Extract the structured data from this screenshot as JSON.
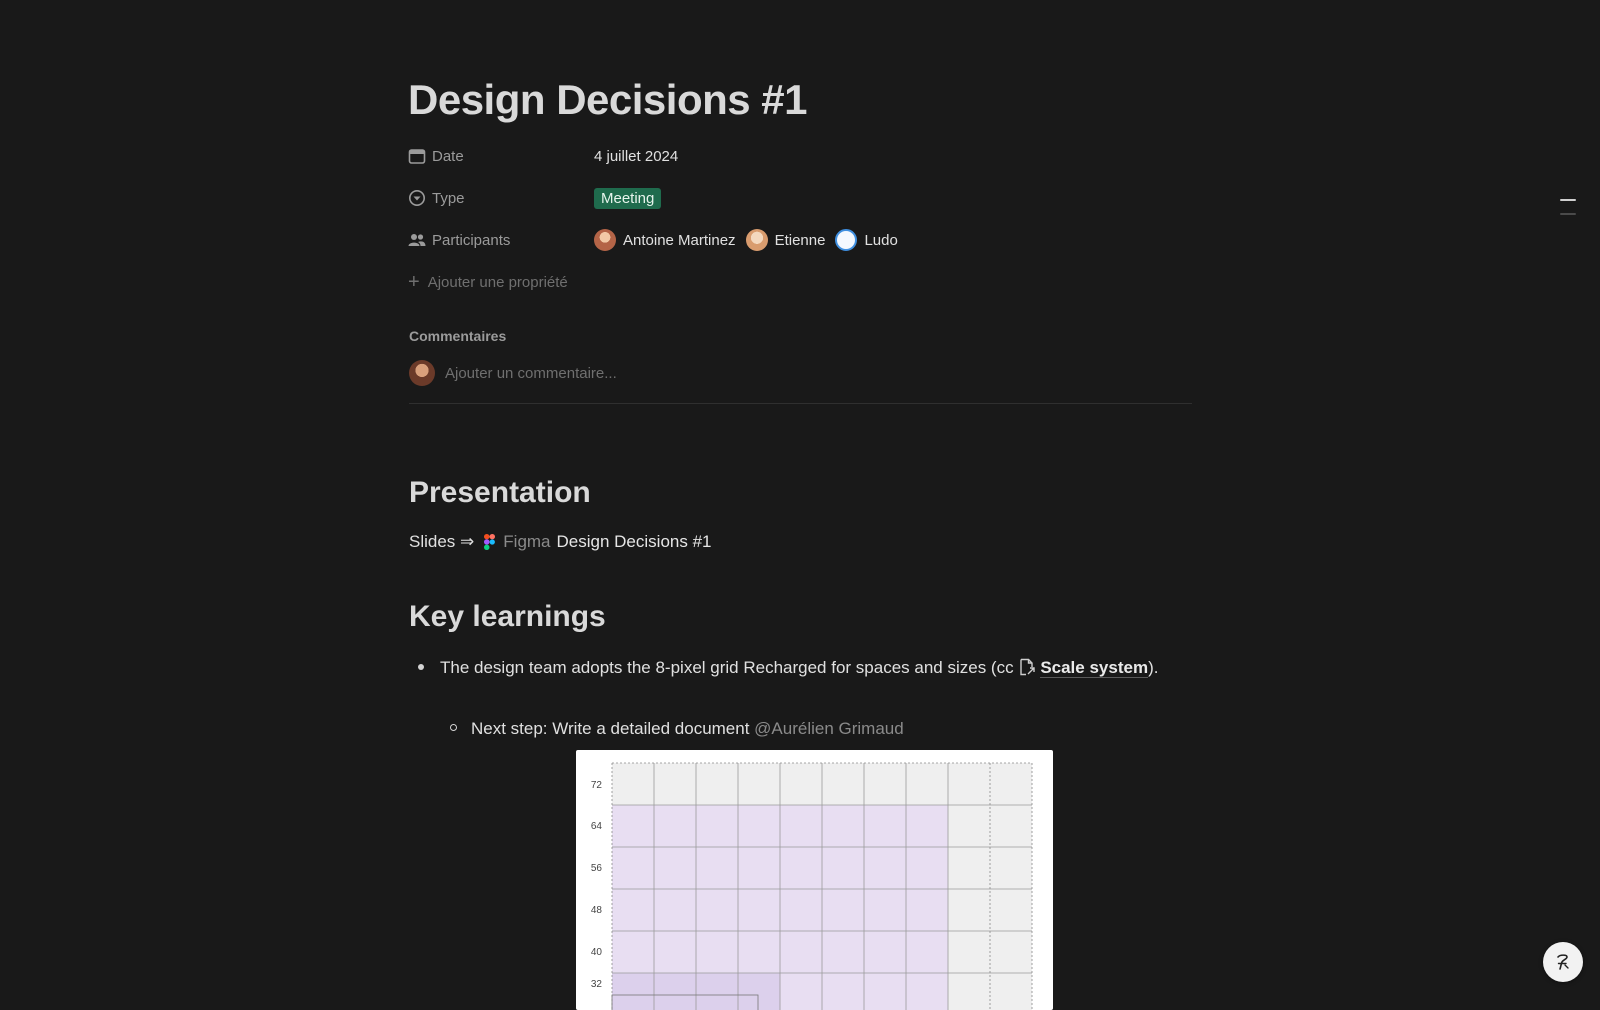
{
  "page": {
    "title": "Design Decisions #1"
  },
  "properties": {
    "date": {
      "label": "Date",
      "value": "4 juillet 2024"
    },
    "type": {
      "label": "Type",
      "value": "Meeting",
      "tag_color": "#1f6b4d"
    },
    "participants": {
      "label": "Participants",
      "people": [
        {
          "name": "Antoine Martinez"
        },
        {
          "name": "Etienne"
        },
        {
          "name": "Ludo"
        }
      ]
    },
    "add_property_label": "Ajouter une propriété"
  },
  "comments": {
    "label": "Commentaires",
    "placeholder": "Ajouter un commentaire..."
  },
  "sections": {
    "presentation": {
      "heading": "Presentation",
      "slides_prefix": "Slides ⇒",
      "figma_label": "Figma",
      "figma_link": "Design Decisions #1"
    },
    "key_learnings": {
      "heading": "Key learnings",
      "bullet_text_before": "The design team adopts the 8-pixel grid Recharged for spaces and sizes (cc ",
      "bullet_link": "Scale system",
      "bullet_text_after": ").",
      "sub_bullet_text": "Next step: Write a detailed document ",
      "sub_bullet_mention": "@Aurélien Grimaud"
    }
  },
  "grid_image": {
    "y_labels": [
      "72",
      "64",
      "56",
      "48",
      "40",
      "32"
    ],
    "highlight_color": "#e8def2",
    "base_color": "#efefef"
  },
  "icons": {
    "date": "calendar-icon",
    "type": "select-circle-icon",
    "participants": "people-icon",
    "add": "plus-icon",
    "help": "help-icon"
  }
}
